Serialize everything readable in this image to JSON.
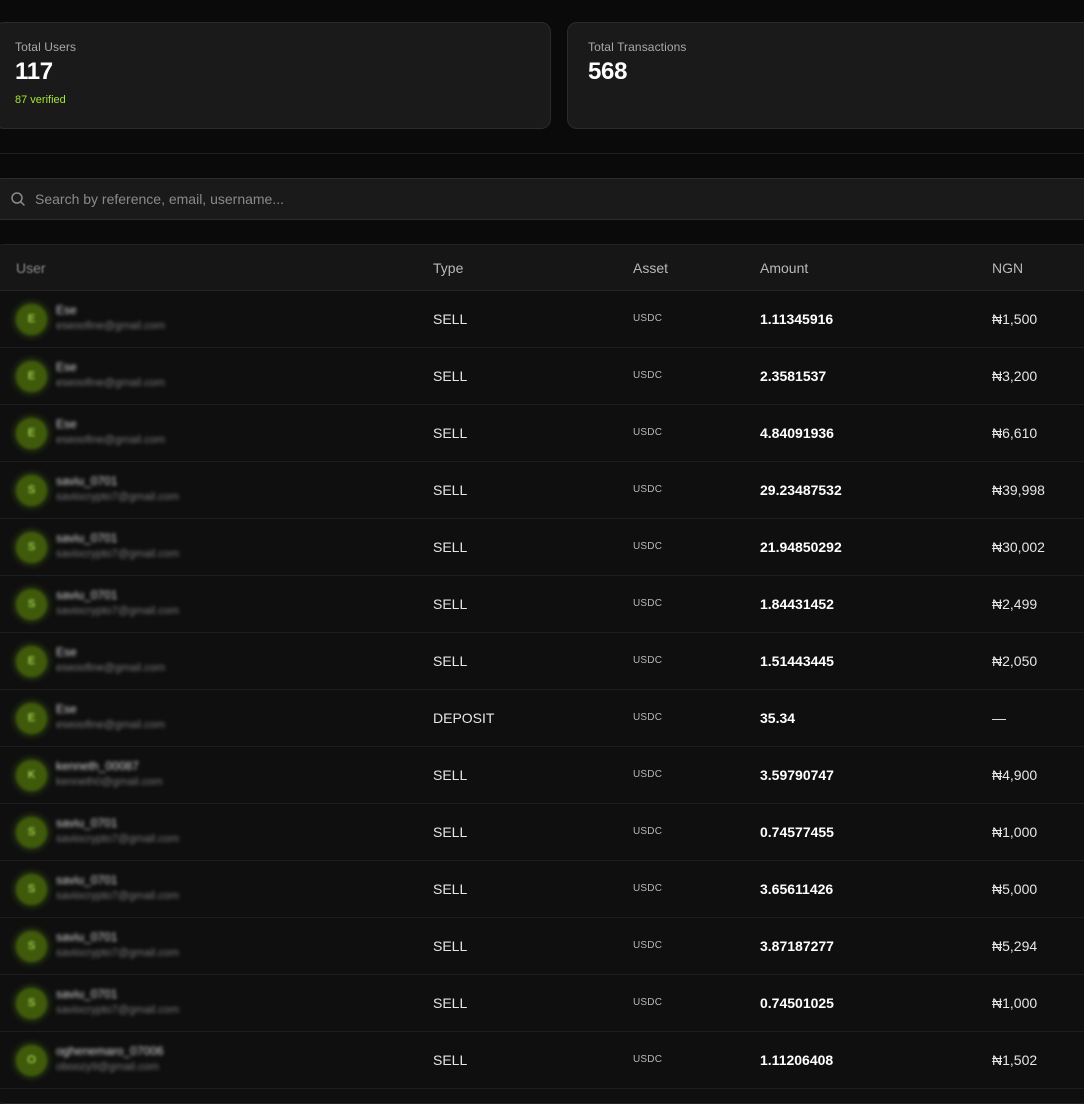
{
  "stats": {
    "total_users": {
      "label": "Total Users",
      "value": "117",
      "sub": "87 verified"
    },
    "total_transactions": {
      "label": "Total Transactions",
      "value": "568"
    }
  },
  "search": {
    "placeholder": "Search by reference, email, username..."
  },
  "table": {
    "columns": {
      "user": "User",
      "type": "Type",
      "asset": "Asset",
      "amount": "Amount",
      "ngn": "NGN"
    },
    "rows": [
      {
        "avatar": "E",
        "name": "Ese",
        "email": "eseoofine@gmail.com",
        "type": "SELL",
        "asset": "USDC",
        "amount": "1.11345916",
        "ngn": "₦1,500"
      },
      {
        "avatar": "E",
        "name": "Ese",
        "email": "eseoofine@gmail.com",
        "type": "SELL",
        "asset": "USDC",
        "amount": "2.3581537",
        "ngn": "₦3,200"
      },
      {
        "avatar": "E",
        "name": "Ese",
        "email": "eseoofine@gmail.com",
        "type": "SELL",
        "asset": "USDC",
        "amount": "4.84091936",
        "ngn": "₦6,610"
      },
      {
        "avatar": "S",
        "name": "saviu_0701",
        "email": "saviocrypto7@gmail.com",
        "type": "SELL",
        "asset": "USDC",
        "amount": "29.23487532",
        "ngn": "₦39,998"
      },
      {
        "avatar": "S",
        "name": "saviu_0701",
        "email": "saviocrypto7@gmail.com",
        "type": "SELL",
        "asset": "USDC",
        "amount": "21.94850292",
        "ngn": "₦30,002"
      },
      {
        "avatar": "S",
        "name": "saviu_0701",
        "email": "saviocrypto7@gmail.com",
        "type": "SELL",
        "asset": "USDC",
        "amount": "1.84431452",
        "ngn": "₦2,499"
      },
      {
        "avatar": "E",
        "name": "Ese",
        "email": "eseoofine@gmail.com",
        "type": "SELL",
        "asset": "USDC",
        "amount": "1.51443445",
        "ngn": "₦2,050"
      },
      {
        "avatar": "E",
        "name": "Ese",
        "email": "eseoofine@gmail.com",
        "type": "DEPOSIT",
        "asset": "USDC",
        "amount": "35.34",
        "ngn": "—"
      },
      {
        "avatar": "K",
        "name": "kenneth_00087",
        "email": "kenneth0@gmail.com",
        "type": "SELL",
        "asset": "USDC",
        "amount": "3.59790747",
        "ngn": "₦4,900"
      },
      {
        "avatar": "S",
        "name": "saviu_0701",
        "email": "saviocrypto7@gmail.com",
        "type": "SELL",
        "asset": "USDC",
        "amount": "0.74577455",
        "ngn": "₦1,000"
      },
      {
        "avatar": "S",
        "name": "saviu_0701",
        "email": "saviocrypto7@gmail.com",
        "type": "SELL",
        "asset": "USDC",
        "amount": "3.65611426",
        "ngn": "₦5,000"
      },
      {
        "avatar": "S",
        "name": "saviu_0701",
        "email": "saviocrypto7@gmail.com",
        "type": "SELL",
        "asset": "USDC",
        "amount": "3.87187277",
        "ngn": "₦5,294"
      },
      {
        "avatar": "S",
        "name": "saviu_0701",
        "email": "saviocrypto7@gmail.com",
        "type": "SELL",
        "asset": "USDC",
        "amount": "0.74501025",
        "ngn": "₦1,000"
      },
      {
        "avatar": "O",
        "name": "oghenemaro_07006",
        "email": "oboozy9@gmail.com",
        "type": "SELL",
        "asset": "USDC",
        "amount": "1.11206408",
        "ngn": "₦1,502"
      }
    ]
  }
}
